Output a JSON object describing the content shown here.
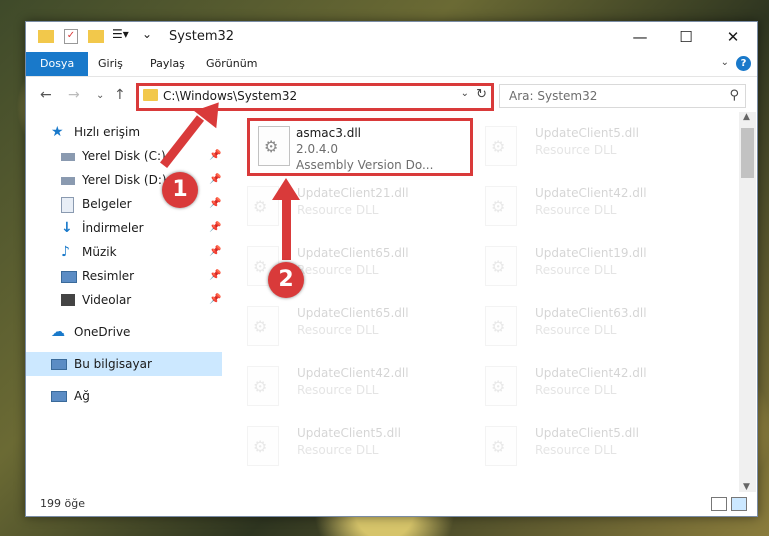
{
  "window": {
    "title": "System32",
    "controls": {
      "minimize": "—",
      "maximize": "☐",
      "close": "✕"
    }
  },
  "ribbon": {
    "tabs": [
      "Dosya",
      "Giriş",
      "Paylaş",
      "Görünüm"
    ],
    "active_tab": "Dosya",
    "expand": "⌄",
    "help": "?"
  },
  "address": {
    "path": "C:\\Windows\\System32",
    "search_placeholder": "Ara: System32"
  },
  "nav": {
    "quick_access": "Hızlı erişim",
    "items": [
      {
        "label": "Yerel Disk (C:)",
        "icon": "drive-icon",
        "pinned": true
      },
      {
        "label": "Yerel Disk (D:)",
        "icon": "drive-icon",
        "pinned": true
      },
      {
        "label": "Belgeler",
        "icon": "documents-icon",
        "pinned": true
      },
      {
        "label": "İndirmeler",
        "icon": "download-icon",
        "pinned": true
      },
      {
        "label": "Müzik",
        "icon": "music-icon",
        "pinned": true
      },
      {
        "label": "Resimler",
        "icon": "pictures-icon",
        "pinned": true
      },
      {
        "label": "Videolar",
        "icon": "video-icon",
        "pinned": true
      }
    ],
    "onedrive": "OneDrive",
    "this_pc": "Bu bilgisayar",
    "network": "Ağ"
  },
  "files": {
    "highlighted": {
      "name": "asmac3.dll",
      "version": "2.0.4.0",
      "description": "Assembly Version Do..."
    },
    "faded_left": [
      {
        "name": "UpdateClient21.dll",
        "type": "Resource DLL"
      },
      {
        "name": "UpdateClient65.dll",
        "type": "Resource DLL"
      },
      {
        "name": "UpdateClient65.dll",
        "type": "Resource DLL"
      },
      {
        "name": "UpdateClient42.dll",
        "type": "Resource DLL"
      },
      {
        "name": "UpdateClient5.dll",
        "type": "Resource DLL"
      }
    ],
    "faded_right": [
      {
        "name": "UpdateClient5.dll",
        "type": "Resource DLL"
      },
      {
        "name": "UpdateClient42.dll",
        "type": "Resource DLL"
      },
      {
        "name": "UpdateClient19.dll",
        "type": "Resource DLL"
      },
      {
        "name": "UpdateClient63.dll",
        "type": "Resource DLL"
      },
      {
        "name": "UpdateClient42.dll",
        "type": "Resource DLL"
      },
      {
        "name": "UpdateClient5.dll",
        "type": "Resource DLL"
      }
    ]
  },
  "status": {
    "item_count": "199 öğe"
  },
  "annotations": {
    "callout_1": "1",
    "callout_2": "2",
    "color": "#d93a3a"
  }
}
